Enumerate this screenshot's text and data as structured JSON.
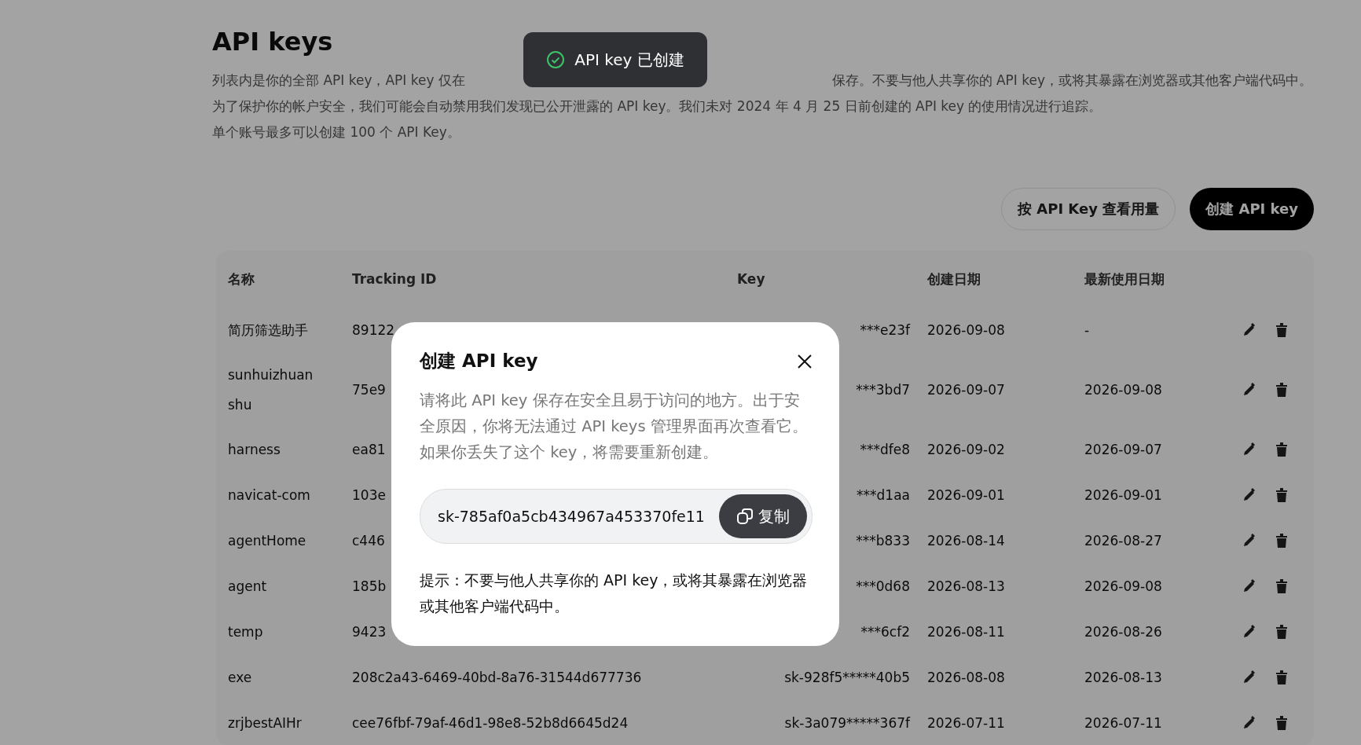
{
  "page": {
    "title": "API keys",
    "description_lines": [
      [
        "列表内是你的全部 API key，API key 仅在",
        "保存。不要与他人共享你的 API key，或将其暴露在浏览器或其他客户端代码中。"
      ],
      [
        "为了保护你的帐户安全，我们可能会自动禁用我们发现已公开泄露的 API key。我们未对 2024 年 4 月 25 日前创建的 API key 的使用情况进行追踪。"
      ],
      [
        "单个账号最多可以创建 100 个 API Key。"
      ]
    ]
  },
  "actions": [
    {
      "label": "按 API Key 查看用量",
      "kind": "secondary"
    },
    {
      "label": "创建 API key",
      "kind": "primary"
    }
  ],
  "table": {
    "columns": [
      "名称",
      "Tracking ID",
      "Key",
      "创建日期",
      "最新使用日期"
    ],
    "rows": [
      {
        "name": "简历筛选助手",
        "tracking_id": "89122",
        "key": "***e23f",
        "created": "2026-09-08",
        "last_used": "-"
      },
      {
        "name": "sunhuizhuan shu",
        "tracking_id": "75e9",
        "key": "***3bd7",
        "created": "2026-09-07",
        "last_used": "2026-09-08"
      },
      {
        "name": "harness",
        "tracking_id": "ea81",
        "key": "***dfe8",
        "created": "2026-09-02",
        "last_used": "2026-09-07"
      },
      {
        "name": "navicat-com",
        "tracking_id": "103e",
        "key": "***d1aa",
        "created": "2026-09-01",
        "last_used": "2026-09-01"
      },
      {
        "name": "agentHome",
        "tracking_id": "c446",
        "key": "***b833",
        "created": "2026-08-14",
        "last_used": "2026-08-27"
      },
      {
        "name": "agent",
        "tracking_id": "185b",
        "key": "***0d68",
        "created": "2026-08-13",
        "last_used": "2026-09-08"
      },
      {
        "name": "temp",
        "tracking_id": "9423",
        "key": "***6cf2",
        "created": "2026-08-11",
        "last_used": "2026-08-26"
      },
      {
        "name": "exe",
        "tracking_id": "208c2a43-6469-40bd-8a76-31544d677736",
        "key": "sk-928f5*****40b5",
        "created": "2026-08-08",
        "last_used": "2026-08-13"
      },
      {
        "name": "zrjbestAIHr",
        "tracking_id": "cee76fbf-79af-46d1-98e8-52b8d6645d24",
        "key": "sk-3a079*****367f",
        "created": "2026-07-11",
        "last_used": "2026-07-11"
      }
    ]
  },
  "toast": {
    "message": "API key 已创建"
  },
  "dialog": {
    "title": "创建 API key",
    "description": "请将此 API key 保存在安全且易于访问的地方。出于安全原因，你将无法通过 API keys 管理界面再次查看它。如果你丢失了这个 key，将需要重新创建。",
    "key_value": "sk-785af0a5cb434967a453370fe11",
    "copy_label": "复制",
    "hint": "提示：不要与他人共享你的 API key，或将其暴露在浏览器或其他客户端代码中。"
  }
}
